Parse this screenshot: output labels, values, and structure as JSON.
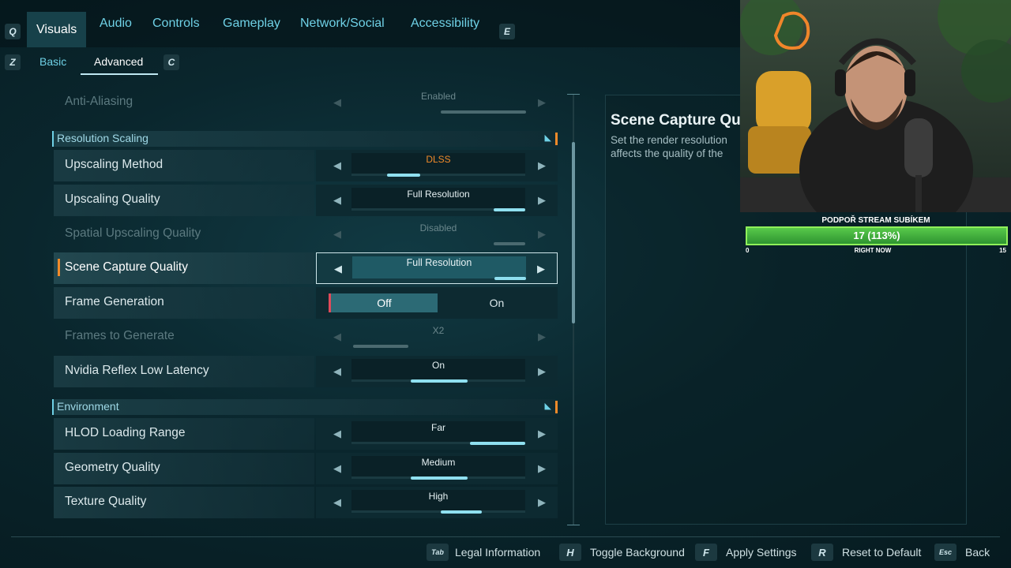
{
  "top_tabs": {
    "left_key": "Q",
    "right_key": "E",
    "items": [
      {
        "label": "Visuals"
      },
      {
        "label": "Audio"
      },
      {
        "label": "Controls"
      },
      {
        "label": "Gameplay"
      },
      {
        "label": "Network/Social"
      },
      {
        "label": "Accessibility"
      }
    ]
  },
  "sub_tabs": {
    "left_key": "Z",
    "right_key": "C",
    "items": [
      {
        "label": "Basic"
      },
      {
        "label": "Advanced"
      }
    ]
  },
  "settings": {
    "anti_aliasing": {
      "label": "Anti-Aliasing",
      "value": "Enabled"
    },
    "section_resolution": "Resolution Scaling",
    "upscaling_method": {
      "label": "Upscaling Method",
      "value": "DLSS"
    },
    "upscaling_quality": {
      "label": "Upscaling Quality",
      "value": "Full Resolution"
    },
    "spatial_upscaling_quality": {
      "label": "Spatial Upscaling Quality",
      "value": "Disabled"
    },
    "scene_capture_quality": {
      "label": "Scene Capture Quality",
      "value": "Full Resolution"
    },
    "frame_generation": {
      "label": "Frame Generation",
      "off": "Off",
      "on": "On"
    },
    "frames_to_generate": {
      "label": "Frames to Generate",
      "value": "X2"
    },
    "nvidia_reflex": {
      "label": "Nvidia Reflex Low Latency",
      "value": "On"
    },
    "section_environment": "Environment",
    "hlod_loading_range": {
      "label": "HLOD Loading Range",
      "value": "Far"
    },
    "geometry_quality": {
      "label": "Geometry Quality",
      "value": "Medium"
    },
    "texture_quality": {
      "label": "Texture Quality",
      "value": "High"
    }
  },
  "description": {
    "title": "Scene Capture Qu",
    "line1": "Set the render resolution",
    "line2": "affects the quality of the"
  },
  "stream_goal": {
    "title": "PODPOŘ STREAM SUBÍKEM",
    "value_text": "17 (113%)",
    "progress_percent": 100,
    "min": "0",
    "label": "RIGHT NOW",
    "max": "15"
  },
  "bottom_hints": [
    {
      "key": "Tab",
      "label": "Legal Information"
    },
    {
      "key": "H",
      "label": "Toggle Background"
    },
    {
      "key": "F",
      "label": "Apply Settings"
    },
    {
      "key": "R",
      "label": "Reset to Default"
    },
    {
      "key": "Esc",
      "label": "Back"
    }
  ],
  "colors": {
    "accent_cyan": "#6fd1e6",
    "accent_orange": "#f08a2a",
    "progress_green": "#58c94a"
  }
}
